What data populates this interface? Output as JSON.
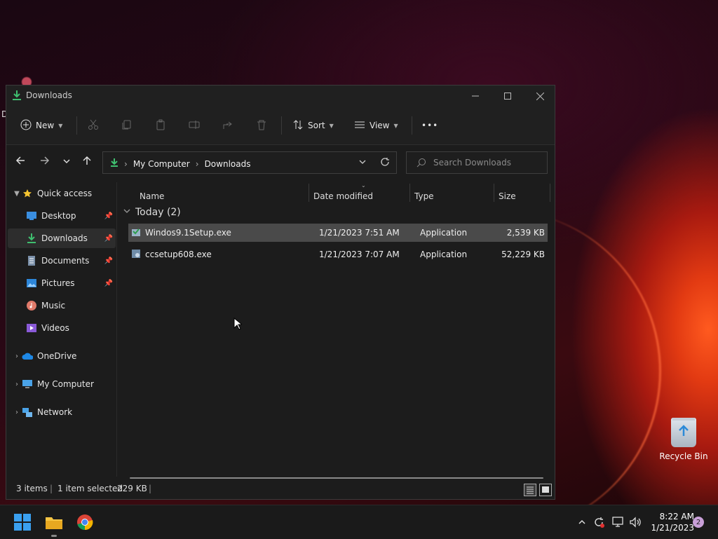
{
  "window": {
    "title": "Downloads"
  },
  "toolbar": {
    "new_label": "New",
    "sort_label": "Sort",
    "view_label": "View",
    "more_label": "•••"
  },
  "address": {
    "crumbs": [
      "My Computer",
      "Downloads"
    ],
    "search_placeholder": "Search Downloads"
  },
  "sidebar": {
    "quick_access": "Quick access",
    "items": [
      {
        "label": "Desktop",
        "pinned": true,
        "icon": "desktop-icon"
      },
      {
        "label": "Downloads",
        "pinned": true,
        "selected": true,
        "icon": "download-icon"
      },
      {
        "label": "Documents",
        "pinned": true,
        "icon": "document-icon"
      },
      {
        "label": "Pictures",
        "pinned": true,
        "icon": "pictures-icon"
      },
      {
        "label": "Music",
        "pinned": false,
        "icon": "music-icon"
      },
      {
        "label": "Videos",
        "pinned": false,
        "icon": "videos-icon"
      }
    ],
    "onedrive": "OneDrive",
    "my_computer": "My Computer",
    "network": "Network"
  },
  "columns": {
    "name": "Name",
    "date": "Date modified",
    "type": "Type",
    "size": "Size"
  },
  "group": {
    "label": "Today (2)"
  },
  "files": [
    {
      "name": "Windos9.1Setup.exe",
      "date": "1/21/2023 7:51 AM",
      "type": "Application",
      "size": "2,539 KB",
      "selected": true
    },
    {
      "name": "ccsetup608.exe",
      "date": "1/21/2023 7:07 AM",
      "type": "Application",
      "size": "52,229 KB",
      "selected": false
    }
  ],
  "status": {
    "items": "3 items",
    "selected": "1 item selected",
    "size": "229 KB"
  },
  "desktop": {
    "recycle_bin": "Recycle Bin",
    "partial_letter": "D"
  },
  "taskbar": {
    "time": "8:22 AM",
    "date": "1/21/2023",
    "notifications": "2"
  },
  "colors": {
    "accent_green": "#3fbf6f",
    "selection": "#4a4a4a"
  }
}
